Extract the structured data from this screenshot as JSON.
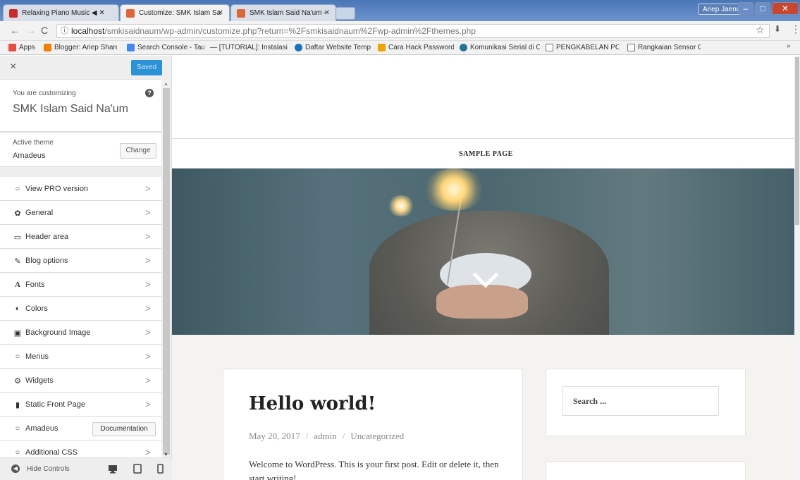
{
  "browser": {
    "tabs": [
      {
        "label": "Relaxing Piano Music ◀︎ ✕",
        "favicon_color": "#cc2b2b"
      },
      {
        "label": "Customize: SMK Islam Sa",
        "favicon_color": "#e0663a"
      },
      {
        "label": "SMK Islam Said Na'um -",
        "favicon_color": "#e0663a"
      }
    ],
    "window_user": "Ariep Jaenul",
    "url_host": "localhost",
    "url_path": "/smkisaidnaum/wp-admin/customize.php?return=%2Fsmkisaidnaum%2Fwp-admin%2Fthemes.php",
    "bookmarks": [
      {
        "label": "Apps",
        "color": "#e84c3d"
      },
      {
        "label": "Blogger: Ariep Share -",
        "color": "#f57d00"
      },
      {
        "label": "Search Console - Tau",
        "color": "#4285f4"
      },
      {
        "label": "— [TUTORIAL]: Instalasi",
        "color": "#888888"
      },
      {
        "label": "Daftar Website Temp",
        "color": "#1a73b8"
      },
      {
        "label": "Cara Hack Password [",
        "color": "#f0a400"
      },
      {
        "label": "Komunikasi Serial di C",
        "color": "#21759b"
      },
      {
        "label": "PENGKABELAN PORT",
        "color": "#777777"
      },
      {
        "label": "Rangkaian Sensor Ge",
        "color": "#777777"
      }
    ]
  },
  "customizer": {
    "close_label": "×",
    "saved_label": "Saved",
    "customizing_label": "You are customizing",
    "site_name": "SMK Islam Said Na'um",
    "help_icon": "?",
    "active_theme_label": "Active theme",
    "theme_name": "Amadeus",
    "change_label": "Change",
    "menu": [
      {
        "icon": "circle-icon",
        "glyph": "○",
        "label": "View PRO version"
      },
      {
        "icon": "gear-icon",
        "glyph": "✿",
        "label": "General"
      },
      {
        "icon": "monitor-icon",
        "glyph": "▭",
        "label": "Header area"
      },
      {
        "icon": "pencil-icon",
        "glyph": "✎",
        "label": "Blog options"
      },
      {
        "icon": "font-icon",
        "glyph": "A",
        "label": "Fonts"
      },
      {
        "icon": "contrast-icon",
        "glyph": "◐",
        "label": "Colors"
      },
      {
        "icon": "image-icon",
        "glyph": "▣",
        "label": "Background Image"
      },
      {
        "icon": "circle-icon",
        "glyph": "○",
        "label": "Menus"
      },
      {
        "icon": "cogs-icon",
        "glyph": "⚙",
        "label": "Widgets"
      },
      {
        "icon": "file-icon",
        "glyph": "▮",
        "label": "Static Front Page"
      },
      {
        "icon": "circle-icon",
        "glyph": "○",
        "label": "Amadeus"
      },
      {
        "icon": "circle-icon",
        "glyph": "○",
        "label": "Additional CSS"
      }
    ],
    "documentation_label": "Documentation",
    "hide_controls_label": "Hide Controls"
  },
  "preview": {
    "nav_label": "SAMPLE PAGE",
    "post_title": "Hello world!",
    "post_date": "May 20, 2017",
    "post_author": "admin",
    "post_category": "Uncategorized",
    "meta_sep": "/",
    "post_excerpt": "Welcome to WordPress. This is your first post. Edit or delete it, then start writing!",
    "search_placeholder": "Search ..."
  }
}
